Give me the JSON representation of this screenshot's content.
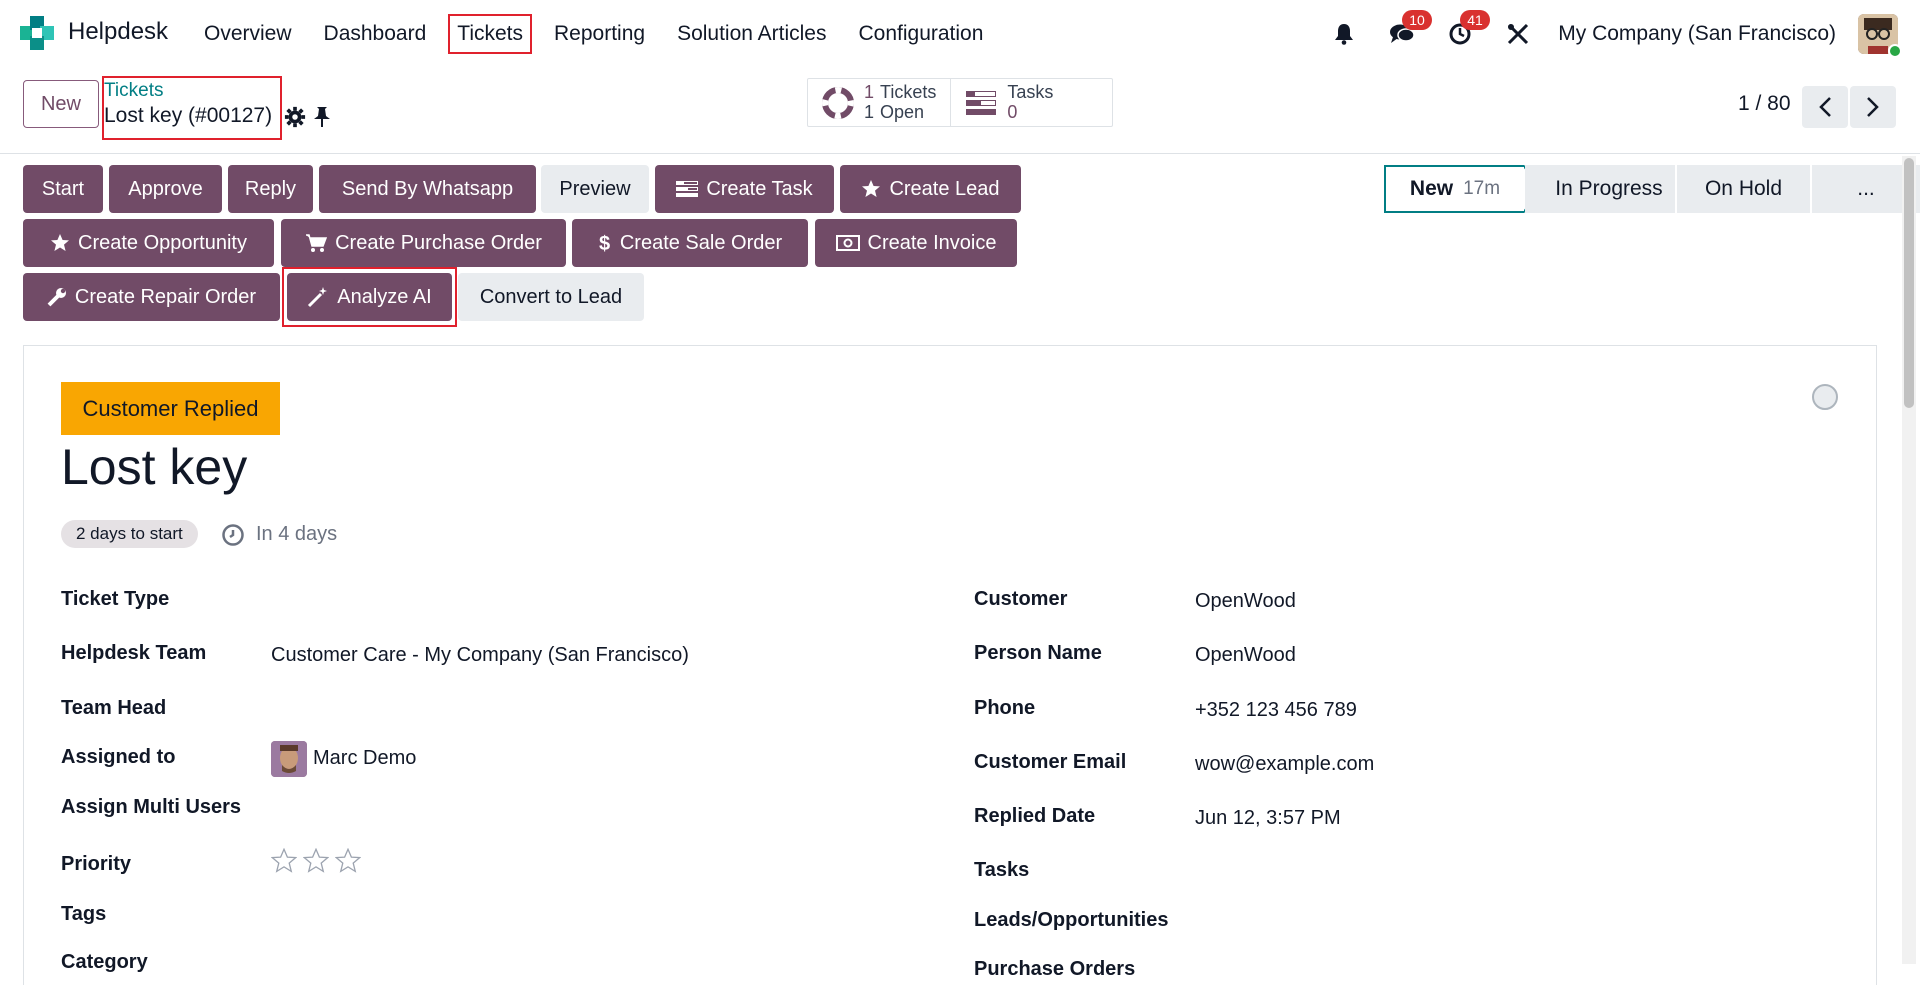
{
  "navbar": {
    "app_name": "Helpdesk",
    "menu": [
      "Overview",
      "Dashboard",
      "Tickets",
      "Reporting",
      "Solution Articles",
      "Configuration"
    ],
    "messages_badge": "10",
    "activities_badge": "41",
    "company": "My Company (San Francisco)"
  },
  "control": {
    "new_label": "New",
    "breadcrumb_parent": "Tickets",
    "breadcrumb_current": "Lost key (#00127)",
    "smart_tickets_count": "1",
    "smart_tickets_label": "Tickets",
    "smart_open_count": "1",
    "smart_open_label": "Open",
    "smart_tasks_label": "Tasks",
    "smart_tasks_count": "0",
    "pager": "1 / 80"
  },
  "actions": {
    "start": "Start",
    "approve": "Approve",
    "reply": "Reply",
    "whatsapp": "Send By Whatsapp",
    "preview": "Preview",
    "create_task": "Create Task",
    "create_lead": "Create Lead",
    "create_opportunity": "Create Opportunity",
    "create_purchase_order": "Create Purchase Order",
    "create_sale_order": "Create Sale Order",
    "create_invoice": "Create Invoice",
    "create_repair_order": "Create Repair Order",
    "analyze_ai": "Analyze AI",
    "convert_to_lead": "Convert to Lead"
  },
  "statusbar": {
    "stages": [
      "New",
      "In Progress",
      "On Hold",
      "..."
    ],
    "active_duration": "17m"
  },
  "ticket": {
    "ribbon": "Customer Replied",
    "title": "Lost key",
    "start_pill": "2 days to start",
    "deadline": "In 4 days",
    "priority_stars": 0,
    "fields_left": {
      "ticket_type_label": "Ticket Type",
      "team_label": "Helpdesk Team",
      "team_value": "Customer Care - My Company (San Francisco)",
      "team_head_label": "Team Head",
      "assigned_label": "Assigned to",
      "assigned_value": "Marc Demo",
      "multi_users_label": "Assign Multi Users",
      "priority_label": "Priority",
      "tags_label": "Tags",
      "category_label": "Category"
    },
    "fields_right": {
      "customer_label": "Customer",
      "customer_value": "OpenWood",
      "person_label": "Person Name",
      "person_value": "OpenWood",
      "phone_label": "Phone",
      "phone_value": "+352 123 456 789",
      "email_label": "Customer Email",
      "email_value": "wow@example.com",
      "replied_label": "Replied Date",
      "replied_value": "Jun 12, 3:57 PM",
      "tasks_label": "Tasks",
      "leads_label": "Leads/Opportunities",
      "purchase_label": "Purchase Orders"
    }
  },
  "colors": {
    "primary": "#714b67",
    "accent": "#017e84",
    "ribbon": "#f9a602",
    "badge": "#d9312f",
    "highlight_box": "#e0212d"
  }
}
